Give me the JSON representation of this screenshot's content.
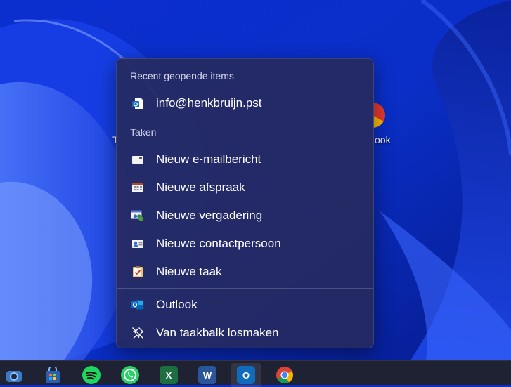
{
  "desktop": {
    "label_left_fragment": "T",
    "label_right_fragment": "ook"
  },
  "jumplist": {
    "recent_header": "Recent geopende items",
    "recent_items": [
      {
        "label": "info@henkbruijn.pst",
        "icon": "outlook-data-file-icon"
      }
    ],
    "tasks_header": "Taken",
    "tasks": [
      {
        "label": "Nieuw e-mailbericht",
        "icon": "new-mail-icon"
      },
      {
        "label": "Nieuwe afspraak",
        "icon": "calendar-icon"
      },
      {
        "label": "Nieuwe vergadering",
        "icon": "meeting-icon"
      },
      {
        "label": "Nieuwe contactpersoon",
        "icon": "contact-card-icon"
      },
      {
        "label": "Nieuwe taak",
        "icon": "task-clipboard-icon"
      }
    ],
    "app_label": "Outlook",
    "unpin_label": "Van taakbalk losmaken"
  },
  "taskbar": {
    "apps": [
      {
        "name": "camera",
        "icon": "camera-icon"
      },
      {
        "name": "store",
        "icon": "store-icon"
      },
      {
        "name": "spotify",
        "icon": "spotify-icon"
      },
      {
        "name": "whatsapp",
        "icon": "whatsapp-icon"
      },
      {
        "name": "excel",
        "icon": "excel-icon",
        "glyph": "X"
      },
      {
        "name": "word",
        "icon": "word-icon",
        "glyph": "W"
      },
      {
        "name": "outlook",
        "icon": "outlook-icon",
        "glyph": "O",
        "active": true
      },
      {
        "name": "chrome",
        "icon": "chrome-icon"
      }
    ]
  },
  "colors": {
    "wallpaper_base": "#0a2fc8",
    "menu_bg": "#262a60",
    "taskbar_bg": "#1f2233",
    "outlook_blue": "#0f6cbd",
    "excel_green": "#1d6f42",
    "word_blue": "#2b579a",
    "spotify_green": "#1ed760",
    "whatsapp_green": "#25d366"
  }
}
